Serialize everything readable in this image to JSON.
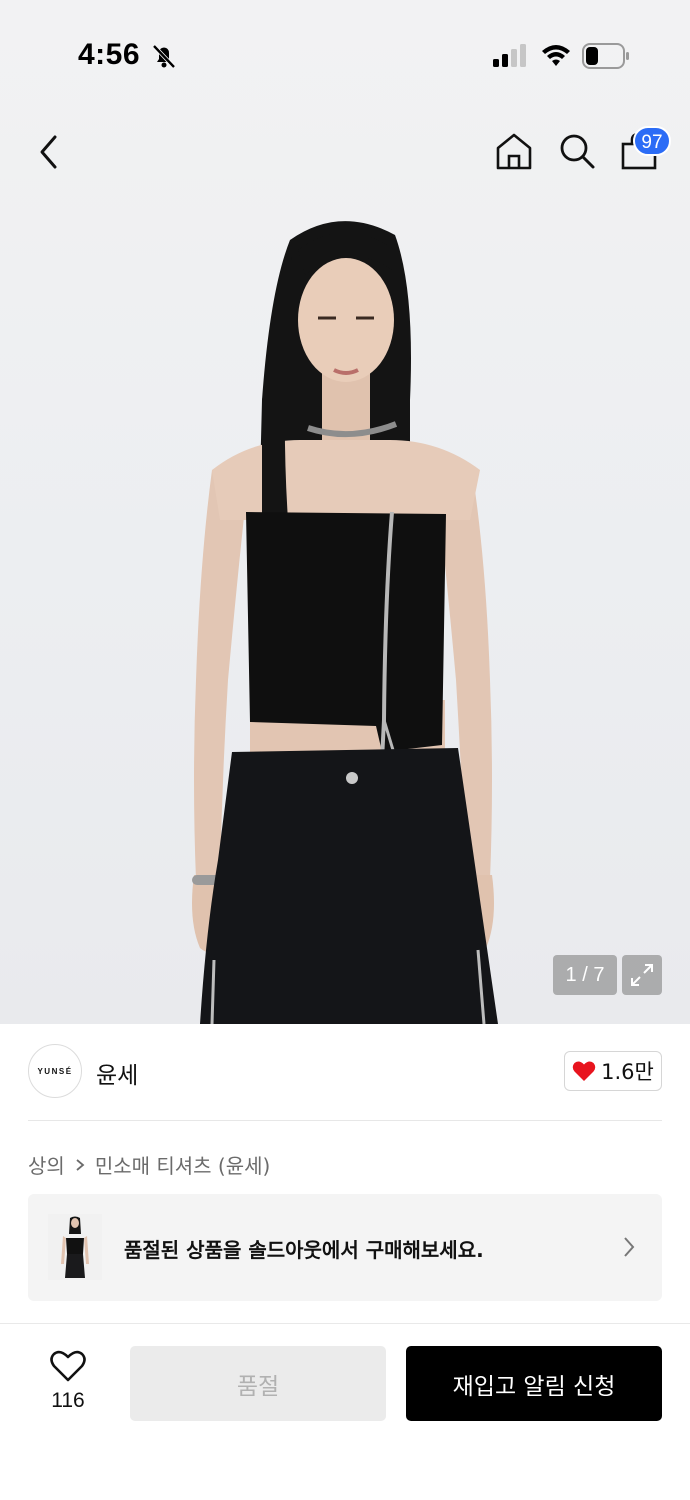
{
  "status_bar": {
    "time": "4:56",
    "icons": [
      "bell-slash-icon",
      "cellular-signal-icon",
      "wifi-icon",
      "battery-icon"
    ]
  },
  "nav": {
    "back_icon": "chevron-left-icon",
    "home_icon": "home-icon",
    "search_icon": "search-icon",
    "cart_icon": "shopping-bag-icon",
    "cart_badge": "97"
  },
  "gallery": {
    "counter": "1 / 7",
    "expand_icon": "expand-icon"
  },
  "brand": {
    "logo_text": "YUNSÉ",
    "name": "윤세",
    "like_count": "1.6만"
  },
  "breadcrumb": {
    "items": [
      "상의",
      "민소매 티셔츠 (윤세)"
    ]
  },
  "promo": {
    "text": "품절된 상품을 솔드아웃에서 구매해보세요."
  },
  "bottom_bar": {
    "wish_count": "116",
    "soldout_label": "품절",
    "restock_label": "재입고 알림 신청"
  },
  "colors": {
    "badge": "#2b6cf6",
    "heart": "#e8141e",
    "primary_button": "#000000",
    "disabled_button": "#ebebeb"
  }
}
